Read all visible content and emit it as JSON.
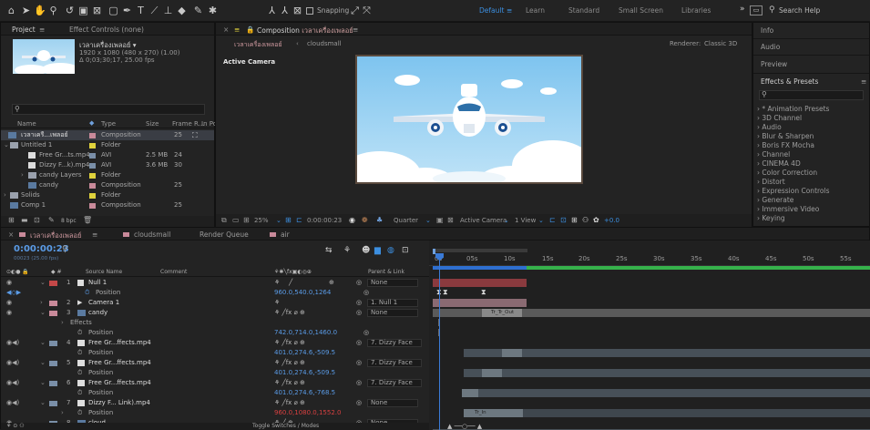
{
  "workspaces": {
    "default": "Default",
    "learn": "Learn",
    "standard": "Standard",
    "small_screen": "Small Screen",
    "libraries": "Libraries",
    "overflow": "»",
    "search_placeholder": "Search Help",
    "snapping": "Snapping"
  },
  "project": {
    "tab": "Project",
    "tab_menu": "≡",
    "effect_controls": "Effect Controls (none)",
    "comp_name": "เวลาเครื่องเพลอย์ ▾",
    "comp_info1": "1920 x 1080 (480 x 270) (1.00)",
    "comp_info2": "Δ 0;03;30;17, 25.00 fps",
    "col_name": "Name",
    "col_type": "Type",
    "col_size": "Size",
    "col_frame": "Frame R...",
    "col_in": "In Po",
    "items": [
      {
        "name": "เวลาเครื...เพลอย์",
        "type": "Composition",
        "size": "",
        "frame": "25"
      },
      {
        "name": "Untitled 1",
        "type": "Folder",
        "size": "",
        "frame": ""
      },
      {
        "name": "Free Gr...ts.mp4",
        "type": "AVI",
        "size": "2.5 MB",
        "frame": "24"
      },
      {
        "name": "Dizzy F...k).mp4",
        "type": "AVI",
        "size": "3.6 MB",
        "frame": "30"
      },
      {
        "name": "candy Layers",
        "type": "Folder",
        "size": "",
        "frame": ""
      },
      {
        "name": "candy",
        "type": "Composition",
        "size": "",
        "frame": "25"
      },
      {
        "name": "Solids",
        "type": "Folder",
        "size": "",
        "frame": ""
      },
      {
        "name": "Comp 1",
        "type": "Composition",
        "size": "",
        "frame": "25"
      }
    ],
    "bpc": "8 bpc"
  },
  "composition": {
    "tab_prefix": "Composition",
    "tab_name": "เวลาเครื่องเพลอย์",
    "tab_menu": "≡",
    "crumb1": "เวลาเครื่องเพลอย์",
    "crumb2": "cloudsmall",
    "renderer": "Renderer:",
    "renderer_value": "Classic 3D",
    "active_camera_label": "Active Camera",
    "zoom": "25%",
    "timecode": "0:00:00:23",
    "resolution": "Quarter",
    "camera": "Active Camera",
    "view": "1 View",
    "exposure": "+0.0"
  },
  "right_panel": {
    "info": "Info",
    "audio": "Audio",
    "preview": "Preview",
    "effects_presets": "Effects & Presets",
    "menu": "≡",
    "items": [
      "* Animation Presets",
      "3D Channel",
      "Audio",
      "Blur & Sharpen",
      "Boris FX Mocha",
      "Channel",
      "CINEMA 4D",
      "Color Correction",
      "Distort",
      "Expression Controls",
      "Generate",
      "Immersive Video",
      "Keying"
    ]
  },
  "timeline": {
    "tabs": [
      "เวลาเครื่องเพลอย์",
      "cloudsmall",
      "Render Queue",
      "air"
    ],
    "tab_menu": "≡",
    "timecode": "0:00:00:23",
    "fps_label": "00023 (25.00 fps)",
    "col_source": "Source Name",
    "col_comment": "Comment",
    "col_parent": "Parent & Link",
    "ruler": [
      "0s",
      "05s",
      "10s",
      "15s",
      "20s",
      "25s",
      "30s",
      "35s",
      "40s",
      "45s",
      "50s",
      "55s"
    ],
    "toggle_label": "Toggle Switches / Modes",
    "rows": [
      {
        "num": "1",
        "name": "Null 1",
        "parent": "None",
        "color": "#c44848",
        "kind": "layer"
      },
      {
        "num": "",
        "name": "Position",
        "value": "960.0,540.0,1264",
        "kind": "prop"
      },
      {
        "num": "2",
        "name": "Camera 1",
        "parent": "1. Null 1",
        "color": "#c98a9a",
        "kind": "layer"
      },
      {
        "num": "3",
        "name": "candy",
        "parent": "None",
        "color": "#c98a9a",
        "kind": "layer"
      },
      {
        "num": "",
        "name": "Effects",
        "kind": "group"
      },
      {
        "num": "",
        "name": "Position",
        "value": "742.0,714.0,1460.0",
        "kind": "prop"
      },
      {
        "num": "4",
        "name": "Free Gr...ffects.mp4",
        "parent": "7. Dizzy Face",
        "color": "#7a8fa8",
        "kind": "layer"
      },
      {
        "num": "",
        "name": "Position",
        "value": "401.0,274.6,-509.5",
        "kind": "prop"
      },
      {
        "num": "5",
        "name": "Free Gr...ffects.mp4",
        "parent": "7. Dizzy Face",
        "color": "#7a8fa8",
        "kind": "layer"
      },
      {
        "num": "",
        "name": "Position",
        "value": "401.0,274.6,-509.5",
        "kind": "prop"
      },
      {
        "num": "6",
        "name": "Free Gr...ffects.mp4",
        "parent": "7. Dizzy Face",
        "color": "#7a8fa8",
        "kind": "layer"
      },
      {
        "num": "",
        "name": "Position",
        "value": "401.0,274.6,-768.5",
        "kind": "prop"
      },
      {
        "num": "7",
        "name": "Dizzy F... Link).mp4",
        "parent": "None",
        "color": "#7a8fa8",
        "kind": "layer"
      },
      {
        "num": "",
        "name": "Position",
        "value": "960.0,1080.0,1552.0",
        "kind": "prop_red"
      },
      {
        "num": "8",
        "name": "cloud",
        "parent": "None",
        "color": "#7a8fa8",
        "kind": "layer"
      }
    ],
    "bar_labels": {
      "tr_out": "Tr_Tr_Out",
      "tr_in": "Tr_In"
    }
  },
  "colors": {
    "accent": "#3c8fe0",
    "playhead": "#3a7ad6",
    "keyframe_red": "#d84040",
    "work_area": "#2e6fd0"
  }
}
